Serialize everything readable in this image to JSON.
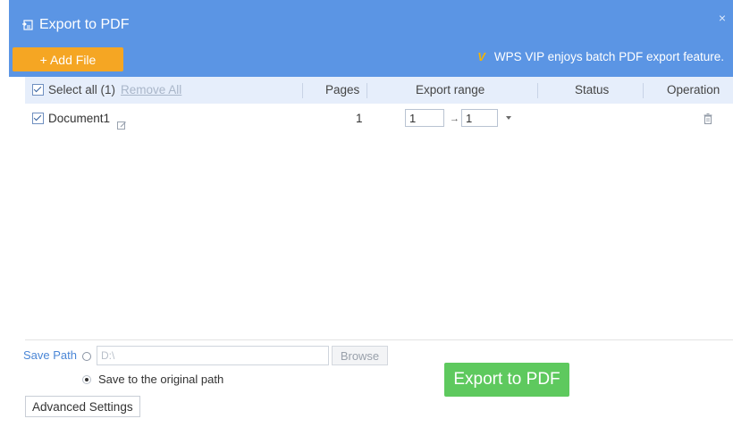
{
  "window": {
    "title": "Export to PDF",
    "title_icon": "export-pdf-icon",
    "close_icon": "close-icon",
    "close_glyph": "×"
  },
  "toolbar": {
    "add_file_label": "+ Add File",
    "vip_icon": "vip-badge-icon",
    "vip_glyph": "V",
    "vip_note": "WPS VIP enjoys batch PDF export feature."
  },
  "table": {
    "select_all_label": "Select all (1)",
    "remove_all_label": "Remove All",
    "columns": [
      "Pages",
      "Export range",
      "Status",
      "Operation"
    ],
    "rows": [
      {
        "name": "Document1",
        "checked": true,
        "pages": "1",
        "range_from": "1",
        "range_arrow": "→",
        "range_to": "1",
        "status": ""
      }
    ]
  },
  "save": {
    "save_path_label": "Save Path",
    "path_value": "D:\\",
    "browse_label": "Browse",
    "original_path_label": "Save to the original path",
    "original_path_selected": true
  },
  "footer": {
    "advanced_settings_label": "Advanced Settings",
    "export_label": "Export to PDF"
  },
  "colors": {
    "header_bg": "#5b95e4",
    "add_file_bg": "#f5a623",
    "export_bg": "#5ec95e",
    "table_head_bg": "#e6eefb",
    "link_blue": "#4a86d6"
  }
}
